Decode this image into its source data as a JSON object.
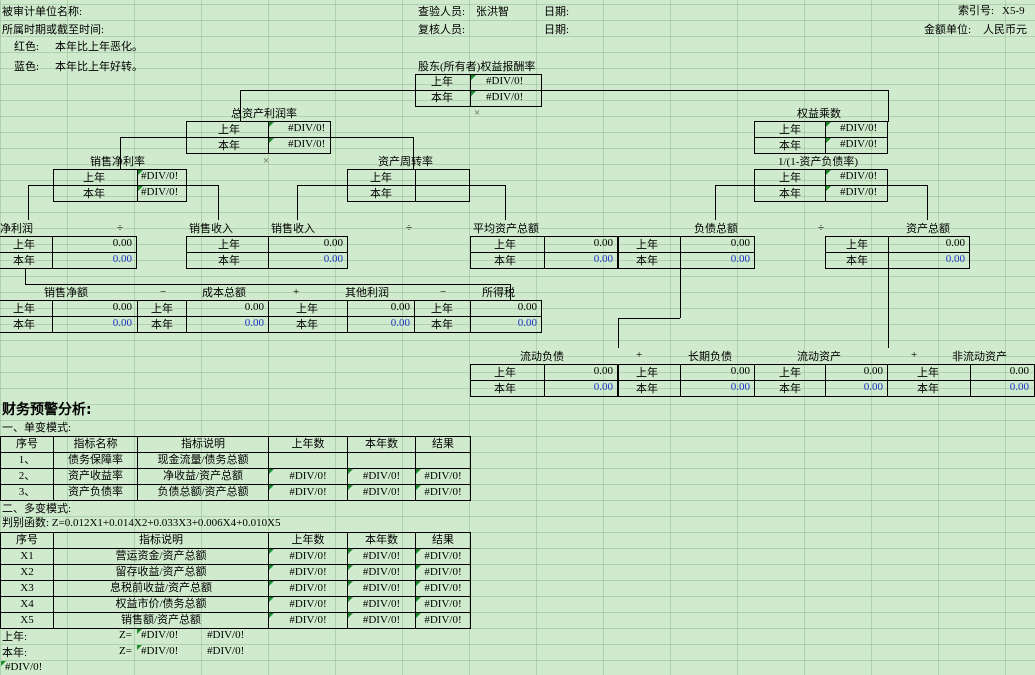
{
  "header": {
    "entity_label": "被审计单位名称:",
    "period_label": "所属时期或截至时间:",
    "checker_label": "查验人员:",
    "checker_name": "张洪智",
    "reviewer_label": "复核人员:",
    "date_label": "日期:",
    "date_label2": "日期:",
    "index_label": "索引号:",
    "index_value": "X5-9",
    "unit_label": "金额单位:",
    "unit_value": "人民币元",
    "legend_red_key": "红色:",
    "legend_red_text": "本年比上年恶化。",
    "legend_blue_key": "蓝色:",
    "legend_blue_text": "本年比上年好转。"
  },
  "labels": {
    "prev": "上年",
    "curr": "本年"
  },
  "values": {
    "div": "#DIV/0!",
    "zero": "0.00"
  },
  "operators": {
    "times": "×",
    "divide": "÷",
    "minus": "−",
    "plus": "+"
  },
  "tree": {
    "roe": "股东(所有者)权益报酬率",
    "roa": "总资产利润率",
    "equity_multiplier": "权益乘数",
    "net_margin": "销售净利率",
    "asset_turnover": "资产周转率",
    "equity_multiplier_formula": "1/(1-资产负债率)",
    "net_profit": "净利润",
    "sales_revenue": "销售收入",
    "sales_revenue2": "销售收入",
    "avg_total_assets": "平均资产总额",
    "total_liabilities": "负债总额",
    "total_assets": "资产总额",
    "net_sales": "销售净额",
    "total_cost": "成本总额",
    "other_profit": "其他利润",
    "income_tax": "所得税",
    "current_liabilities": "流动负债",
    "long_term_liabilities": "长期负债",
    "current_assets": "流动资产",
    "non_current_assets": "非流动资产"
  },
  "warning": {
    "title": "财务预警分析:",
    "single_title": "一、单变模式:",
    "single_headers": [
      "序号",
      "指标名称",
      "指标说明",
      "上年数",
      "本年数",
      "结果"
    ],
    "single_rows": [
      {
        "no": "1、",
        "name": "债务保障率",
        "desc": "现金流量/债务总额"
      },
      {
        "no": "2、",
        "name": "资产收益率",
        "desc": "净收益/资产总额"
      },
      {
        "no": "3、",
        "name": "资产负债率",
        "desc": "负债总额/资产总额"
      }
    ],
    "multi_title": "二、多变模式:",
    "formula": "判别函数: Z=0.012X1+0.014X2+0.033X3+0.006X4+0.010X5",
    "multi_headers": [
      "序号",
      "指标说明",
      "上年数",
      "本年数",
      "结果"
    ],
    "multi_rows": [
      {
        "no": "X1",
        "desc": "营运资金/资产总额"
      },
      {
        "no": "X2",
        "desc": "留存收益/资产总额"
      },
      {
        "no": "X3",
        "desc": "息税前收益/资产总额"
      },
      {
        "no": "X4",
        "desc": "权益市价/债务总额"
      },
      {
        "no": "X5",
        "desc": "销售额/资产总额"
      }
    ],
    "z_prev_label": "上年:",
    "z_curr_label": "本年:",
    "z_eq": "Z=",
    "bottom_value": "#DIV/0!"
  }
}
